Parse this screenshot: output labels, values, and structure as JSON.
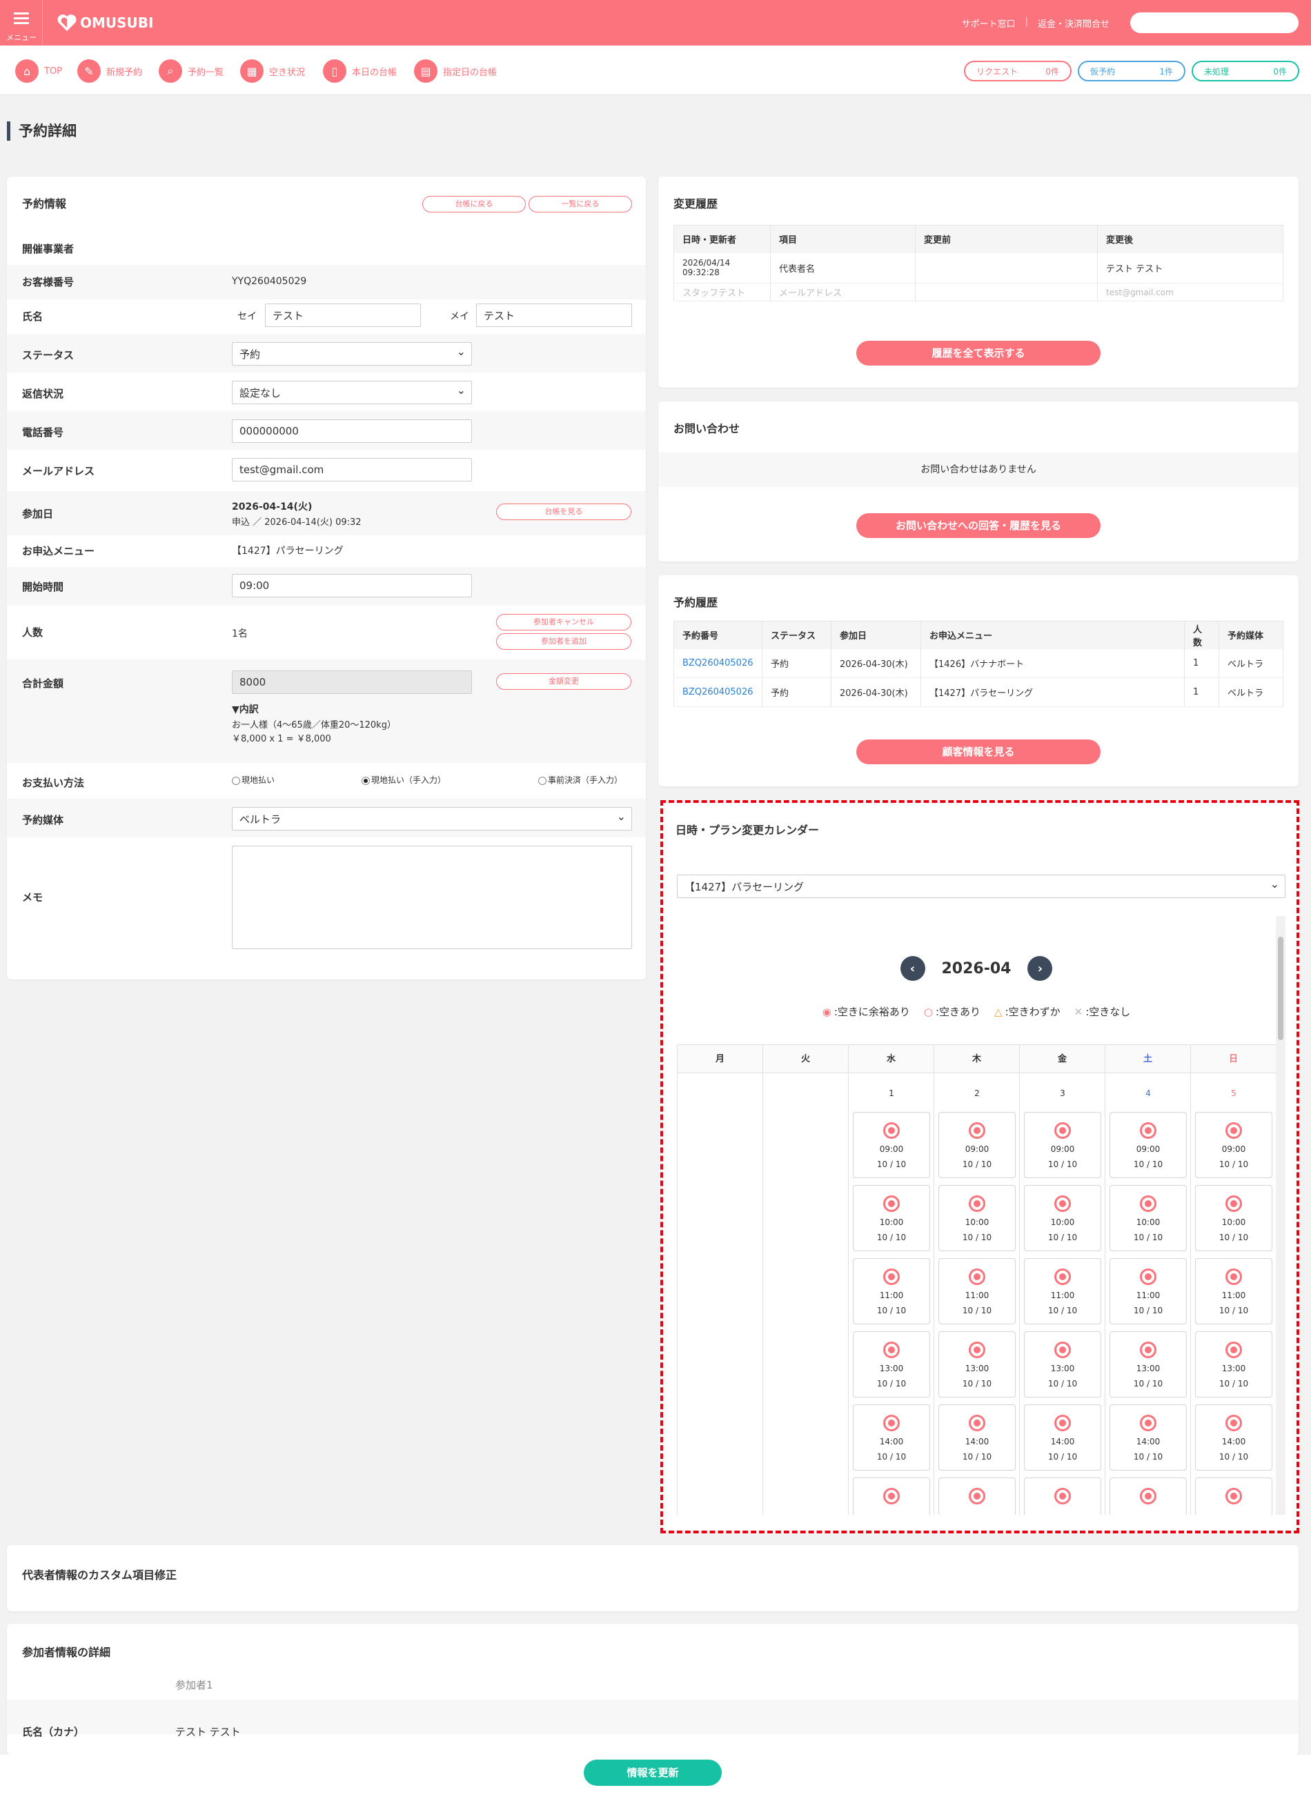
{
  "header": {
    "menu_label": "メニュー",
    "logo": "OMUSUBI",
    "support": "サポート窓口",
    "separator": "|",
    "refund": "返金・決済間合せ"
  },
  "nav": [
    {
      "label": "TOP",
      "icon": "home-icon"
    },
    {
      "label": "新規予約",
      "icon": "edit-icon"
    },
    {
      "label": "予約一覧",
      "icon": "search-icon"
    },
    {
      "label": "空き状況",
      "icon": "grid-icon"
    },
    {
      "label": "本日の台帳",
      "icon": "book-icon"
    },
    {
      "label": "指定日の台帳",
      "icon": "calendar-icon"
    }
  ],
  "pills": [
    {
      "label": "リクエスト",
      "count": "0件",
      "color": "#fb737c"
    },
    {
      "label": "仮予約",
      "count": "1件",
      "color": "#4aa3df"
    },
    {
      "label": "未処理",
      "count": "0件",
      "color": "#16c2a3"
    }
  ],
  "page_title": "予約詳細",
  "reservation": {
    "title": "予約情報",
    "btn_ledger_back": "台帳に戻る",
    "btn_list_back": "一覧に戻る",
    "organizer_label": "開催事業者",
    "customer_no_label": "お客様番号",
    "customer_no": "YYQ260405029",
    "name_label": "氏名",
    "sei_label": "セイ",
    "sei": "テスト",
    "mei_label": "メイ",
    "mei": "テスト",
    "status_label": "ステータス",
    "status": "予約",
    "reply_label": "返信状況",
    "reply": "設定なし",
    "phone_label": "電話番号",
    "phone": "000000000",
    "email_label": "メールアドレス",
    "email": "test@gmail.com",
    "date_label": "参加日",
    "date": "2026-04-14(火)",
    "applied": "申込 ／ 2026-04-14(火) 09:32",
    "btn_view_ledger": "台帳を見る",
    "menu_label": "お申込メニュー",
    "menu": "【1427】パラセーリング",
    "start_label": "開始時間",
    "start": "09:00",
    "people_label": "人数",
    "people": "1名",
    "btn_cancel": "参加者キャンセル",
    "btn_add": "参加者を追加",
    "total_label": "合計金額",
    "total": "8000",
    "btn_amount": "金額変更",
    "breakdown_title": "▼内訳",
    "breakdown_line1": "お一人様（4〜65歳／体重20〜120kg）",
    "breakdown_line2": "￥8,000 x 1 = ￥8,000",
    "pay_label": "お支払い方法",
    "pay1": "現地払い",
    "pay2": "現地払い（手入力）",
    "pay3": "事前決済（手入力）",
    "media_label": "予約媒体",
    "media": "ベルトラ",
    "memo_label": "メモ"
  },
  "history": {
    "title": "変更履歴",
    "headers": [
      "日時・更新者",
      "項目",
      "変更前",
      "変更後"
    ],
    "row1": {
      "date": "2026/04/14",
      "time": "09:32:28",
      "item": "代表者名",
      "before": "",
      "after": "テスト テスト"
    },
    "row2": {
      "user": "スタッフテスト",
      "item": "メールアドレス",
      "before": "",
      "after": "test@gmail.com"
    },
    "btn": "履歴を全て表示する"
  },
  "inquiry": {
    "title": "お問い合わせ",
    "empty": "お問い合わせはありません",
    "btn": "お問い合わせへの回答・履歴を見る"
  },
  "booking_history": {
    "title": "予約履歴",
    "headers": [
      "予約番号",
      "ステータス",
      "参加日",
      "お申込メニュー",
      "人数",
      "予約媒体"
    ],
    "rows": [
      [
        "BZQ260405026",
        "予約",
        "2026-04-30(木)",
        "【1426】バナナボート",
        "1",
        "ベルトラ"
      ],
      [
        "BZQ260405026",
        "予約",
        "2026-04-30(木)",
        "【1427】パラセーリング",
        "1",
        "ベルトラ"
      ]
    ],
    "btn": "顧客情報を見る"
  },
  "calendar": {
    "title": "日時・プラン変更カレンダー",
    "plan": "【1427】パラセーリング",
    "month": "2026-04",
    "legend": [
      ":空きに余裕あり",
      ":空きあり",
      ":空きわずか",
      ":空きなし"
    ],
    "weekdays": [
      "月",
      "火",
      "水",
      "木",
      "金",
      "土",
      "日"
    ],
    "days": [
      "1",
      "2",
      "3",
      "4",
      "5"
    ],
    "times": [
      "09:00",
      "10:00",
      "11:00",
      "13:00",
      "14:00"
    ],
    "capacity": "10 / 10"
  },
  "custom": {
    "title": "代表者情報のカスタム項目修正"
  },
  "participants": {
    "title": "参加者情報の詳細",
    "p1": "参加者1",
    "kana_label": "氏名（カナ）",
    "kana": "テスト テスト"
  },
  "update_btn": "情報を更新"
}
